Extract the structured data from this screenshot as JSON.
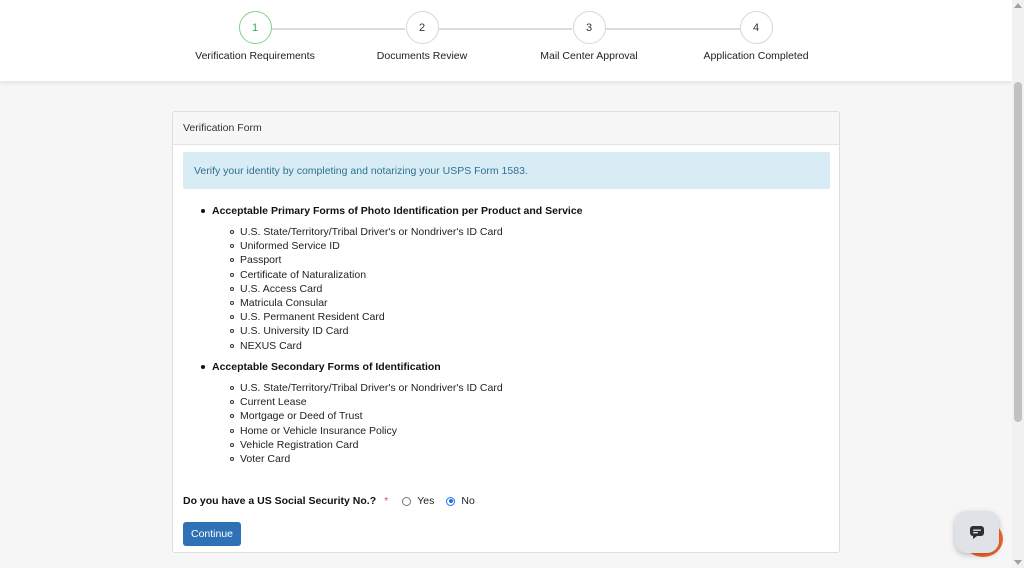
{
  "stepper": {
    "steps": [
      {
        "number": "1",
        "label": "Verification Requirements",
        "active": true
      },
      {
        "number": "2",
        "label": "Documents Review",
        "active": false
      },
      {
        "number": "3",
        "label": "Mail Center Approval",
        "active": false
      },
      {
        "number": "4",
        "label": "Application Completed",
        "active": false
      }
    ]
  },
  "form": {
    "header": "Verification Form",
    "alert": "Verify your identity by completing and notarizing your USPS Form 1583.",
    "primary": {
      "title": "Acceptable Primary Forms of Photo Identification per Product and Service",
      "items": [
        "U.S. State/Territory/Tribal Driver's or Nondriver's ID Card",
        "Uniformed Service ID",
        "Passport",
        "Certificate of Naturalization",
        "U.S. Access Card",
        "Matricula Consular",
        "U.S. Permanent Resident Card",
        "U.S. University ID Card",
        "NEXUS Card"
      ]
    },
    "secondary": {
      "title": "Acceptable Secondary Forms of Identification",
      "items": [
        "U.S. State/Territory/Tribal Driver's or Nondriver's ID Card",
        "Current Lease",
        "Mortgage or Deed of Trust",
        "Home or Vehicle Insurance Policy",
        "Vehicle Registration Card",
        "Voter Card"
      ]
    },
    "ssn_question": {
      "label": "Do you have a US Social Security No.?",
      "required_marker": "*",
      "options": [
        {
          "label": "Yes",
          "checked": false
        },
        {
          "label": "No",
          "checked": true
        }
      ]
    },
    "continue_label": "Continue"
  },
  "chat": {
    "icon": "chat-bubble-icon"
  }
}
